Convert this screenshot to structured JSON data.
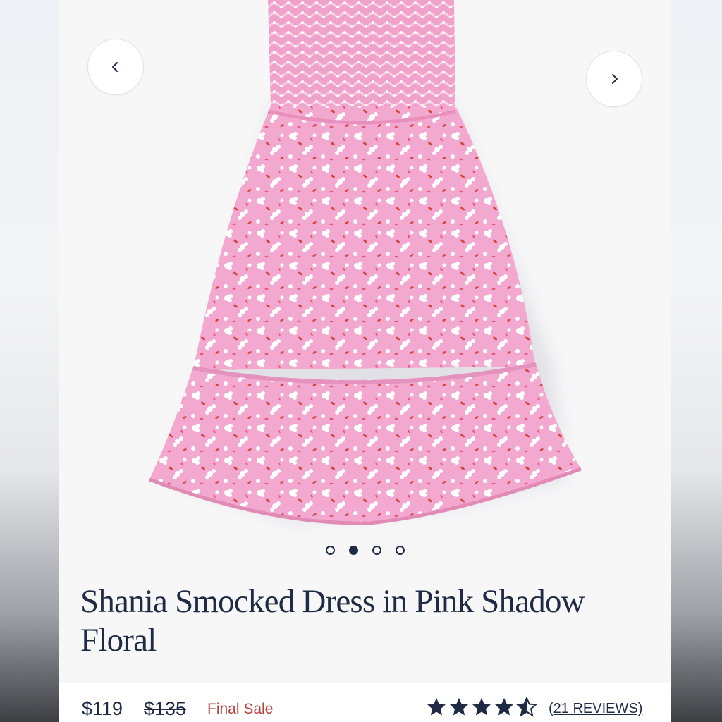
{
  "carousel": {
    "prev_icon": "chevron-left-icon",
    "next_icon": "chevron-right-icon",
    "image_alt": "pink floral smocked dress",
    "dot_count": 4,
    "active_index": 1
  },
  "product": {
    "title": "Shania Smocked Dress in Pink Shadow Floral",
    "price": "$119",
    "original_price": "$135",
    "sale_label": "Final Sale",
    "rating": 4.5,
    "rating_max": 5,
    "reviews_label": "(21 REVIEWS)"
  },
  "colors": {
    "navy": "#1f2a44",
    "sale_red": "#b8413e",
    "dress_pink": "#f1a6cc",
    "dress_red_accent": "#d2463f"
  }
}
